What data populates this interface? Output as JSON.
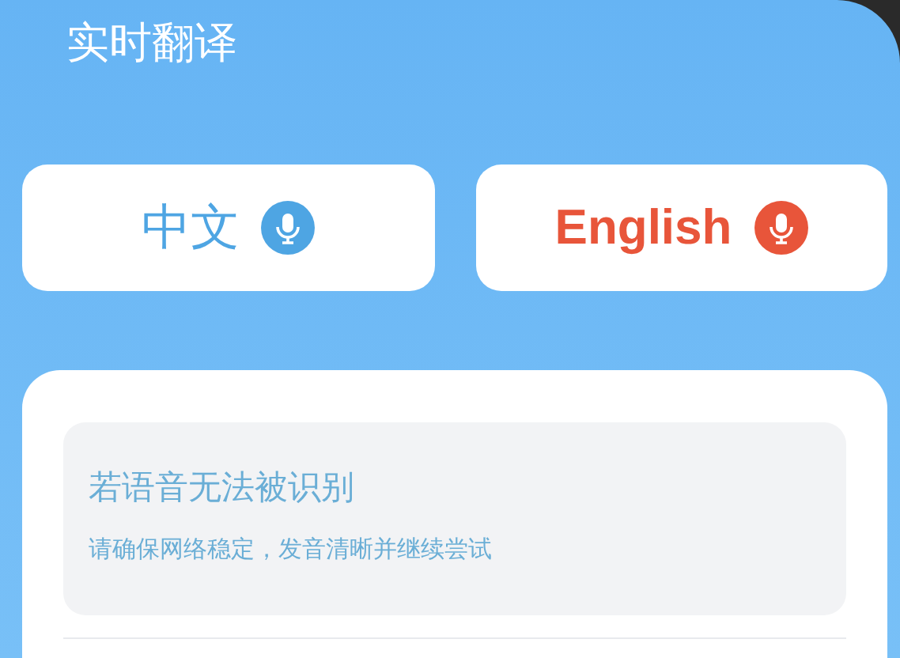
{
  "header": {
    "title": "实时翻译"
  },
  "languages": [
    {
      "label": "中文",
      "color": "#4ea5e3"
    },
    {
      "label": "English",
      "color": "#e8553a"
    }
  ],
  "tip": {
    "title": "若语音无法被识别",
    "message": "请确保网络稳定，发音清晰并继续尝试"
  }
}
